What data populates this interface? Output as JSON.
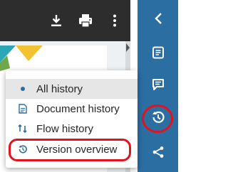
{
  "toolbar": {
    "icons": [
      "download-icon",
      "print-icon",
      "more-vertical-icon"
    ]
  },
  "sidebar": {
    "icons": [
      "chevron-left-icon",
      "document-icon",
      "comment-icon",
      "history-icon",
      "share-icon"
    ],
    "highlight_color": "#e3121d"
  },
  "history_menu": {
    "items": [
      {
        "label": "All history",
        "icon": "dot-icon",
        "selected": true
      },
      {
        "label": "Document history",
        "icon": "document-icon",
        "selected": false
      },
      {
        "label": "Flow history",
        "icon": "flow-arrows-icon",
        "selected": false
      },
      {
        "label": "Version overview",
        "icon": "history-icon",
        "selected": false,
        "highlighted": true
      }
    ]
  },
  "colors": {
    "sidebar": "#2b6ea2",
    "toolbar": "#2d2d2d",
    "accent": "#2b6ea2",
    "highlight_ring": "#e3121d"
  }
}
